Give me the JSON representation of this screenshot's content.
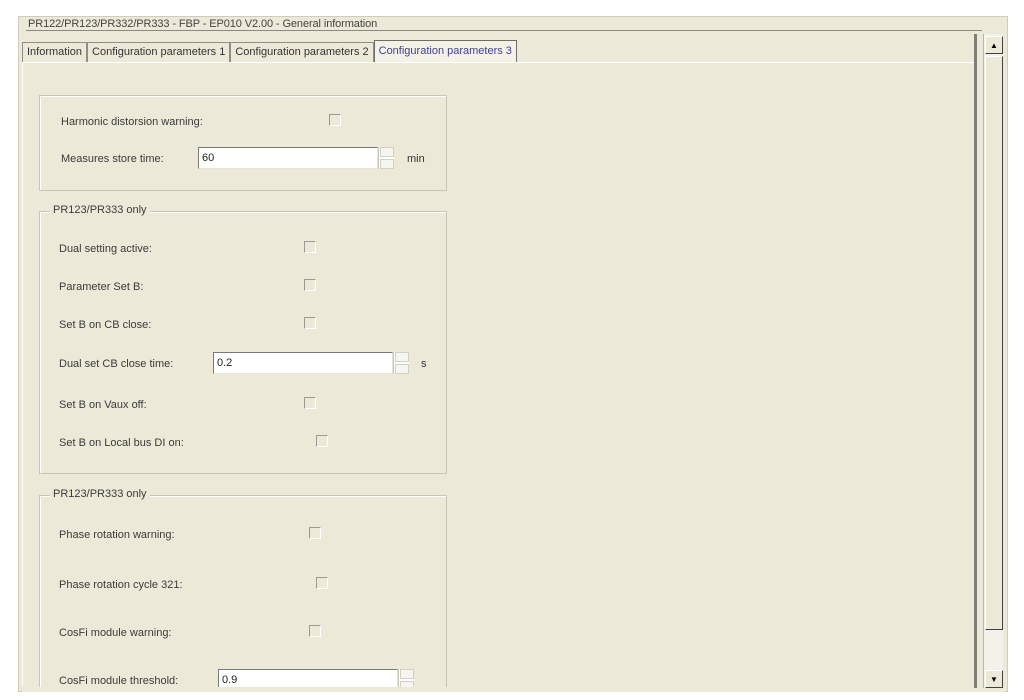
{
  "window": {
    "title": "PR122/PR123/PR332/PR333 - FBP - EP010 V2.00 - General information"
  },
  "tabs": [
    {
      "label": "Information"
    },
    {
      "label": "Configuration parameters 1"
    },
    {
      "label": "Configuration parameters 2"
    },
    {
      "label": "Configuration parameters 3",
      "active": true
    }
  ],
  "group1": {
    "harmonic_label": "Harmonic distorsion warning:",
    "harmonic_checked": false,
    "measures_label": "Measures store time:",
    "measures_value": "60",
    "measures_unit": "min"
  },
  "group2": {
    "title": "PR123/PR333 only",
    "dual_setting_label": "Dual setting active:",
    "param_set_b_label": "Parameter Set B:",
    "set_b_cb_close_label": "Set B on CB close:",
    "dual_set_cb_label": "Dual set CB close time:",
    "dual_set_cb_value": "0.2",
    "dual_set_cb_unit": "s",
    "set_b_vaux_label": "Set B on Vaux off:",
    "set_b_localbus_label": "Set B on Local bus DI on:"
  },
  "group3": {
    "title": "PR123/PR333 only",
    "phase_rot_warning_label": "Phase rotation warning:",
    "phase_rot_cycle_label": "Phase rotation cycle 321:",
    "cosfi_warning_label": "CosFi module warning:",
    "cosfi_threshold_label": "CosFi module threshold:",
    "cosfi_threshold_value": "0.9"
  },
  "scrollbar": {
    "up_icon": "▲",
    "down_icon": "▼"
  }
}
